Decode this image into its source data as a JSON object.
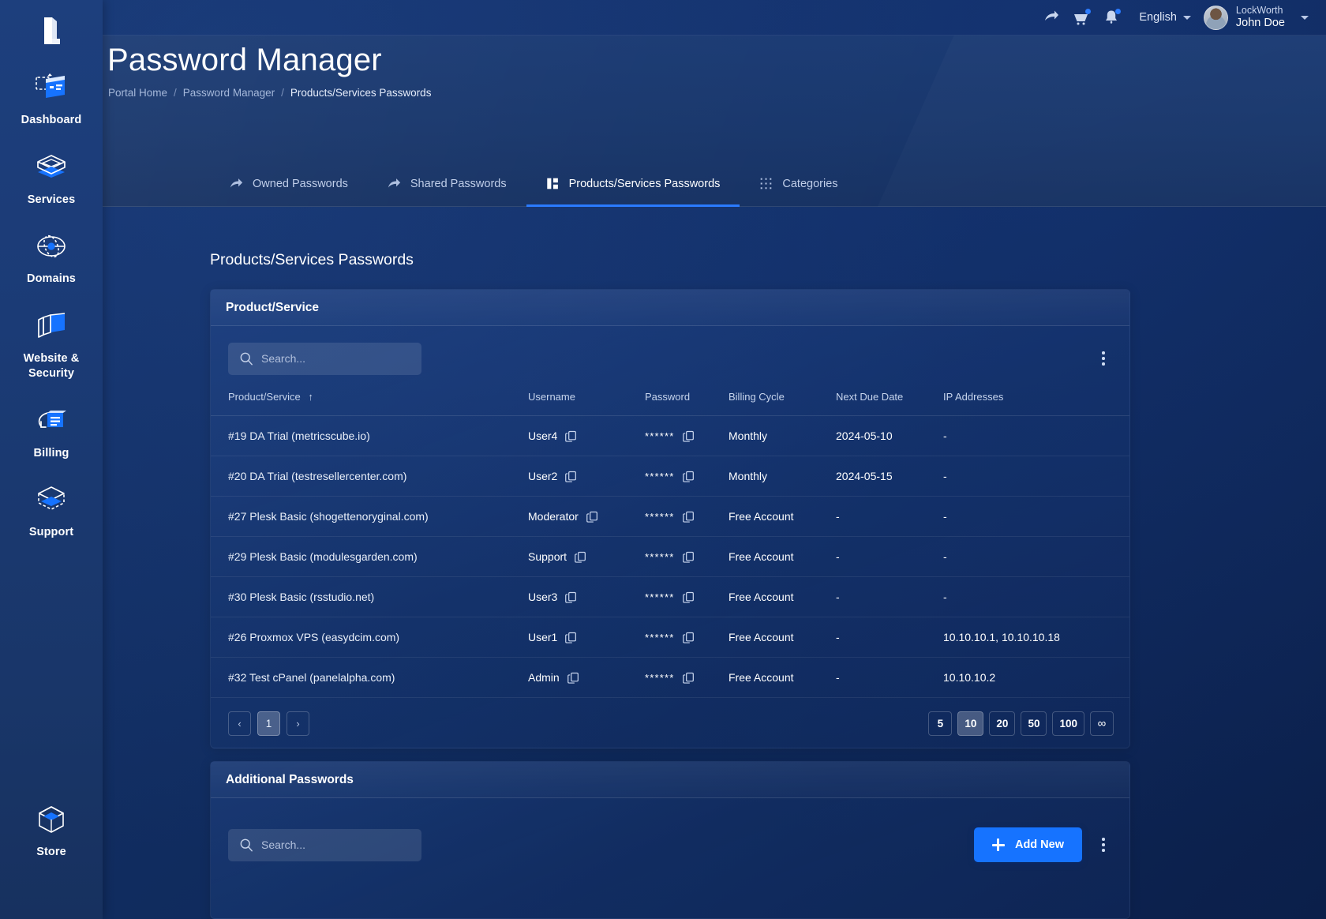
{
  "brand": {
    "logo_icon": "lockworth-logo-icon"
  },
  "sidebar": {
    "items": [
      {
        "label": "Dashboard",
        "icon": "dashboard-icon"
      },
      {
        "label": "Services",
        "icon": "services-layers-icon"
      },
      {
        "label": "Domains",
        "icon": "domains-globe-icon"
      },
      {
        "label": "Website & Security",
        "icon": "website-security-icon"
      },
      {
        "label": "Billing",
        "icon": "billing-invoice-icon"
      },
      {
        "label": "Support",
        "icon": "support-box-icon"
      }
    ],
    "bottom": {
      "label": "Store",
      "icon": "store-cube-icon"
    }
  },
  "topbar": {
    "share_icon": "share-arrow-icon",
    "cart_icon": "cart-icon",
    "bell_icon": "notification-bell-icon",
    "language": "English",
    "user": {
      "org": "LockWorth",
      "name": "John Doe"
    }
  },
  "header": {
    "title": "Password Manager",
    "breadcrumb": [
      {
        "label": "Portal Home",
        "current": false
      },
      {
        "label": "Password Manager",
        "current": false
      },
      {
        "label": "Products/Services Passwords",
        "current": true
      }
    ]
  },
  "tabs": [
    {
      "label": "Owned Passwords",
      "icon": "arrow-share-icon",
      "active": false
    },
    {
      "label": "Shared Passwords",
      "icon": "arrow-share-icon",
      "active": false
    },
    {
      "label": "Products/Services Passwords",
      "icon": "panels-icon",
      "active": true
    },
    {
      "label": "Categories",
      "icon": "grid-dots-icon",
      "active": false
    }
  ],
  "main": {
    "section_title": "Products/Services Passwords"
  },
  "products_card": {
    "title": "Product/Service",
    "search": {
      "placeholder": "Search...",
      "value": ""
    },
    "menu_icon": "kebab-menu-icon",
    "columns": [
      "Product/Service",
      "Username",
      "Password",
      "Billing Cycle",
      "Next Due Date",
      "IP Addresses"
    ],
    "sort_indicator": "↑",
    "rows": [
      {
        "product": "#19 DA Trial (metricscube.io)",
        "username": "User4",
        "password": "******",
        "billing": "Monthly",
        "due": "2024-05-10",
        "ips": "-"
      },
      {
        "product": "#20 DA Trial (testresellercenter.com)",
        "username": "User2",
        "password": "******",
        "billing": "Monthly",
        "due": "2024-05-15",
        "ips": "-"
      },
      {
        "product": "#27 Plesk Basic (shogettenoryginal.com)",
        "username": "Moderator",
        "password": "******",
        "billing": "Free Account",
        "due": "-",
        "ips": "-"
      },
      {
        "product": "#29 Plesk Basic (modulesgarden.com)",
        "username": "Support",
        "password": "******",
        "billing": "Free Account",
        "due": "-",
        "ips": "-"
      },
      {
        "product": "#30 Plesk Basic (rsstudio.net)",
        "username": "User3",
        "password": "******",
        "billing": "Free Account",
        "due": "-",
        "ips": "-"
      },
      {
        "product": "#26 Proxmox VPS (easydcim.com)",
        "username": "User1",
        "password": "******",
        "billing": "Free Account",
        "due": "-",
        "ips": "10.10.10.1, 10.10.10.18"
      },
      {
        "product": "#32 Test cPanel (panelalpha.com)",
        "username": "Admin",
        "password": "******",
        "billing": "Free Account",
        "due": "-",
        "ips": "10.10.10.2"
      }
    ],
    "pagination": {
      "prev": "‹",
      "next": "›",
      "pages": [
        "1"
      ],
      "current_page": "1",
      "page_sizes": [
        "5",
        "10",
        "20",
        "50",
        "100",
        "∞"
      ],
      "active_size": "10"
    }
  },
  "additional_card": {
    "title": "Additional Passwords",
    "search": {
      "placeholder": "Search...",
      "value": ""
    },
    "add_button": "Add New",
    "menu_icon": "kebab-menu-icon"
  },
  "colors": {
    "accent": "#1673ff",
    "tab_underline": "#2b7bff",
    "sidebar": "#1d3f7d",
    "page_bg": "#123061"
  }
}
